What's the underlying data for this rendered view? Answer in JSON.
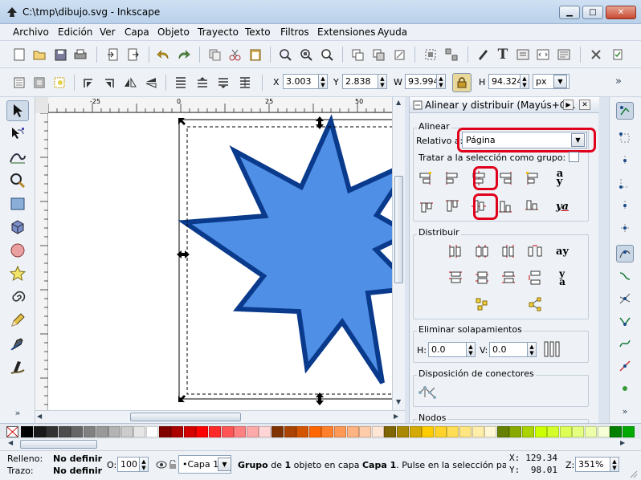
{
  "window": {
    "title": "C:\\tmp\\dibujo.svg - Inkscape",
    "minimize": "▁",
    "maximize": "□",
    "close": "✕"
  },
  "menu": [
    "Archivo",
    "Edición",
    "Ver",
    "Capa",
    "Objeto",
    "Trayecto",
    "Texto",
    "Filtros",
    "Extensiones",
    "Ayuda"
  ],
  "selection_toolbar": {
    "x_label": "X",
    "x_value": "3.003",
    "y_label": "Y",
    "y_value": "2.838",
    "w_label": "W",
    "w_value": "93.994",
    "h_label": "H",
    "h_value": "94.324",
    "unit": "px",
    "overflow": "»"
  },
  "ruler": {
    "ticks": [
      "-25",
      "0",
      "25",
      "50"
    ]
  },
  "dock": {
    "title": "Alinear y distribuir (Mayús+C...",
    "align_section": "Alinear",
    "relative_label": "Relativo a:",
    "relative_value": "Página",
    "group_label": "Tratar a la selección como grupo:",
    "distribute_section": "Distribuir",
    "remove_overlap_section": "Eliminar solapamientos",
    "h_label": "H:",
    "h_value": "0.0",
    "v_label": "V:",
    "v_value": "0.0",
    "connectors_section": "Disposición de conectores",
    "nodes_section": "Nodos"
  },
  "status": {
    "fill_label": "Relleno:",
    "fill_value": "No definir",
    "stroke_label": "Trazo:",
    "stroke_value": "No definir",
    "opacity_label": "O:",
    "opacity_value": "100",
    "layer": "•Capa 1",
    "message_bold1": "Grupo",
    "message_part2": " de ",
    "message_bold2": "1",
    "message_part3": " objeto en capa ",
    "message_bold3": "Capa 1",
    "message_part4": ". Pulse en la selección para co",
    "x_label": "X:",
    "x_value": "129.34",
    "y_label": "Y:",
    "y_value": "98.01",
    "zoom_label": "Z:",
    "zoom_value": "351%"
  },
  "colors": {
    "star_fill": "#4f8fe6",
    "star_stroke": "#0a3a8c",
    "highlight": "#e0001b"
  },
  "palette": [
    "#000000",
    "#1a1a1a",
    "#333333",
    "#4d4d4d",
    "#666666",
    "#808080",
    "#999999",
    "#b3b3b3",
    "#cccccc",
    "#e6e6e6",
    "#ffffff",
    "#800000",
    "#aa0000",
    "#d40000",
    "#ff0000",
    "#ff2a2a",
    "#ff5555",
    "#ff8080",
    "#ffaaaa",
    "#ffd5d5",
    "#803300",
    "#aa4400",
    "#d45500",
    "#ff6600",
    "#ff7f2a",
    "#ff9955",
    "#ffb380",
    "#ffccaa",
    "#ffe6d5",
    "#806600",
    "#aa8800",
    "#d4aa00",
    "#ffcc00",
    "#ffd42a",
    "#ffdd55",
    "#ffe680",
    "#ffeeaa",
    "#fff6d5",
    "#668000",
    "#88aa00",
    "#aad400",
    "#ccff00",
    "#d4ff2a",
    "#ddff55",
    "#e5ff80",
    "#eeffaa",
    "#f6ffd5",
    "#008000",
    "#00aa00"
  ]
}
